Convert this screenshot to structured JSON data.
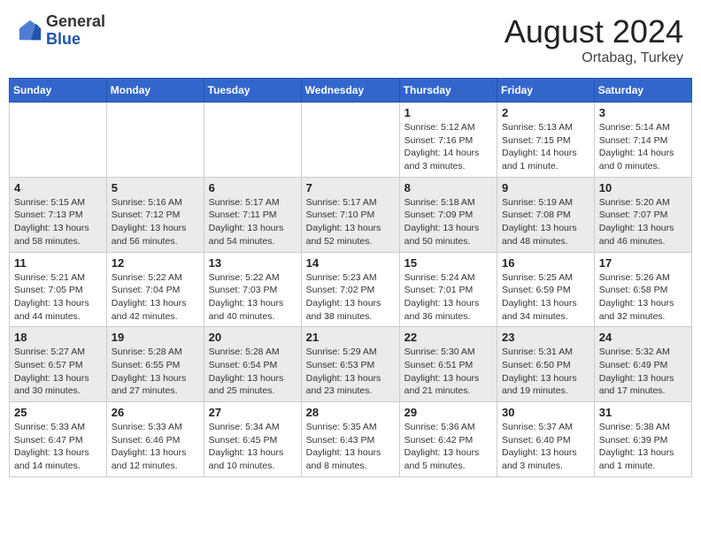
{
  "header": {
    "logo_general": "General",
    "logo_blue": "Blue",
    "month_year": "August 2024",
    "location": "Ortabag, Turkey"
  },
  "weekdays": [
    "Sunday",
    "Monday",
    "Tuesday",
    "Wednesday",
    "Thursday",
    "Friday",
    "Saturday"
  ],
  "weeks": [
    [
      {
        "day": "",
        "info": ""
      },
      {
        "day": "",
        "info": ""
      },
      {
        "day": "",
        "info": ""
      },
      {
        "day": "",
        "info": ""
      },
      {
        "day": "1",
        "info": "Sunrise: 5:12 AM\nSunset: 7:16 PM\nDaylight: 14 hours\nand 3 minutes."
      },
      {
        "day": "2",
        "info": "Sunrise: 5:13 AM\nSunset: 7:15 PM\nDaylight: 14 hours\nand 1 minute."
      },
      {
        "day": "3",
        "info": "Sunrise: 5:14 AM\nSunset: 7:14 PM\nDaylight: 14 hours\nand 0 minutes."
      }
    ],
    [
      {
        "day": "4",
        "info": "Sunrise: 5:15 AM\nSunset: 7:13 PM\nDaylight: 13 hours\nand 58 minutes."
      },
      {
        "day": "5",
        "info": "Sunrise: 5:16 AM\nSunset: 7:12 PM\nDaylight: 13 hours\nand 56 minutes."
      },
      {
        "day": "6",
        "info": "Sunrise: 5:17 AM\nSunset: 7:11 PM\nDaylight: 13 hours\nand 54 minutes."
      },
      {
        "day": "7",
        "info": "Sunrise: 5:17 AM\nSunset: 7:10 PM\nDaylight: 13 hours\nand 52 minutes."
      },
      {
        "day": "8",
        "info": "Sunrise: 5:18 AM\nSunset: 7:09 PM\nDaylight: 13 hours\nand 50 minutes."
      },
      {
        "day": "9",
        "info": "Sunrise: 5:19 AM\nSunset: 7:08 PM\nDaylight: 13 hours\nand 48 minutes."
      },
      {
        "day": "10",
        "info": "Sunrise: 5:20 AM\nSunset: 7:07 PM\nDaylight: 13 hours\nand 46 minutes."
      }
    ],
    [
      {
        "day": "11",
        "info": "Sunrise: 5:21 AM\nSunset: 7:05 PM\nDaylight: 13 hours\nand 44 minutes."
      },
      {
        "day": "12",
        "info": "Sunrise: 5:22 AM\nSunset: 7:04 PM\nDaylight: 13 hours\nand 42 minutes."
      },
      {
        "day": "13",
        "info": "Sunrise: 5:22 AM\nSunset: 7:03 PM\nDaylight: 13 hours\nand 40 minutes."
      },
      {
        "day": "14",
        "info": "Sunrise: 5:23 AM\nSunset: 7:02 PM\nDaylight: 13 hours\nand 38 minutes."
      },
      {
        "day": "15",
        "info": "Sunrise: 5:24 AM\nSunset: 7:01 PM\nDaylight: 13 hours\nand 36 minutes."
      },
      {
        "day": "16",
        "info": "Sunrise: 5:25 AM\nSunset: 6:59 PM\nDaylight: 13 hours\nand 34 minutes."
      },
      {
        "day": "17",
        "info": "Sunrise: 5:26 AM\nSunset: 6:58 PM\nDaylight: 13 hours\nand 32 minutes."
      }
    ],
    [
      {
        "day": "18",
        "info": "Sunrise: 5:27 AM\nSunset: 6:57 PM\nDaylight: 13 hours\nand 30 minutes."
      },
      {
        "day": "19",
        "info": "Sunrise: 5:28 AM\nSunset: 6:55 PM\nDaylight: 13 hours\nand 27 minutes."
      },
      {
        "day": "20",
        "info": "Sunrise: 5:28 AM\nSunset: 6:54 PM\nDaylight: 13 hours\nand 25 minutes."
      },
      {
        "day": "21",
        "info": "Sunrise: 5:29 AM\nSunset: 6:53 PM\nDaylight: 13 hours\nand 23 minutes."
      },
      {
        "day": "22",
        "info": "Sunrise: 5:30 AM\nSunset: 6:51 PM\nDaylight: 13 hours\nand 21 minutes."
      },
      {
        "day": "23",
        "info": "Sunrise: 5:31 AM\nSunset: 6:50 PM\nDaylight: 13 hours\nand 19 minutes."
      },
      {
        "day": "24",
        "info": "Sunrise: 5:32 AM\nSunset: 6:49 PM\nDaylight: 13 hours\nand 17 minutes."
      }
    ],
    [
      {
        "day": "25",
        "info": "Sunrise: 5:33 AM\nSunset: 6:47 PM\nDaylight: 13 hours\nand 14 minutes."
      },
      {
        "day": "26",
        "info": "Sunrise: 5:33 AM\nSunset: 6:46 PM\nDaylight: 13 hours\nand 12 minutes."
      },
      {
        "day": "27",
        "info": "Sunrise: 5:34 AM\nSunset: 6:45 PM\nDaylight: 13 hours\nand 10 minutes."
      },
      {
        "day": "28",
        "info": "Sunrise: 5:35 AM\nSunset: 6:43 PM\nDaylight: 13 hours\nand 8 minutes."
      },
      {
        "day": "29",
        "info": "Sunrise: 5:36 AM\nSunset: 6:42 PM\nDaylight: 13 hours\nand 5 minutes."
      },
      {
        "day": "30",
        "info": "Sunrise: 5:37 AM\nSunset: 6:40 PM\nDaylight: 13 hours\nand 3 minutes."
      },
      {
        "day": "31",
        "info": "Sunrise: 5:38 AM\nSunset: 6:39 PM\nDaylight: 13 hours\nand 1 minute."
      }
    ]
  ]
}
